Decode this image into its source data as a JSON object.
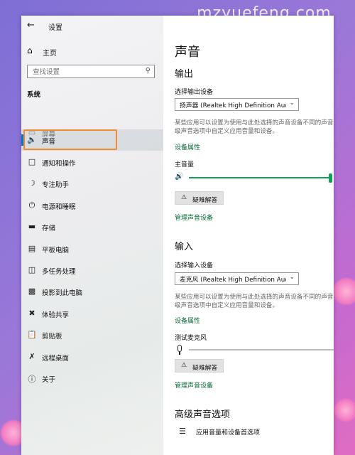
{
  "watermark": "mzyuefeng.com",
  "window": {
    "title": "设置",
    "home_label": "主页",
    "search_placeholder": "查找设置",
    "section_label": "系统"
  },
  "nav_items": [
    {
      "label": "屏幕",
      "icon": "monitor-icon"
    },
    {
      "label": "声音",
      "icon": "speaker-icon",
      "active": true
    },
    {
      "label": "通知和操作",
      "icon": "notification-icon"
    },
    {
      "label": "专注助手",
      "icon": "moon-icon"
    },
    {
      "label": "电源和睡眠",
      "icon": "power-icon"
    },
    {
      "label": "存储",
      "icon": "storage-icon"
    },
    {
      "label": "平板电脑",
      "icon": "tablet-icon"
    },
    {
      "label": "多任务处理",
      "icon": "multitask-icon"
    },
    {
      "label": "投影到此电脑",
      "icon": "project-icon"
    },
    {
      "label": "体验共享",
      "icon": "share-icon"
    },
    {
      "label": "剪贴板",
      "icon": "clipboard-icon"
    },
    {
      "label": "远程桌面",
      "icon": "remote-icon"
    },
    {
      "label": "关于",
      "icon": "info-icon"
    }
  ],
  "content": {
    "page_title": "声音",
    "output": {
      "heading": "输出",
      "device_label": "选择输出设备",
      "device_value": "扬声器 (Realtek High Definition Audi...",
      "desc_line1": "某些应用可以设置为使用与此处选择的声音设备不同的声音",
      "desc_line2": "级声音选项中自定义应用音量和设备。",
      "device_properties": "设备属性",
      "volume_label": "主音量",
      "volume_level": 1.0,
      "troubleshoot": "疑难解答",
      "manage_devices": "管理声音设备"
    },
    "input": {
      "heading": "输入",
      "device_label": "选择输入设备",
      "device_value": "麦克风 (Realtek High Definition Audi...",
      "desc_line1": "某些应用可以设置为使用与此处选择的声音设备不同的声音",
      "desc_line2": "级声音选项中自定义应用音量和设备。",
      "device_properties": "设备属性",
      "test_label": "测试麦克风",
      "troubleshoot": "疑难解答",
      "manage_devices": "管理声音设备"
    },
    "advanced": {
      "heading": "高级声音选项",
      "item_label": "应用音量和设备首选项"
    }
  },
  "colors": {
    "accent": "#0078d4",
    "link": "#0b6a3a",
    "slider": "#11a05a",
    "highlight": "#f28a2e"
  }
}
